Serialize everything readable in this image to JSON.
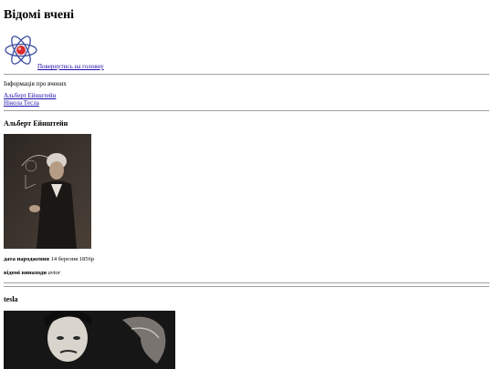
{
  "page": {
    "title": "Відомі вчені",
    "home_link": "Повернутись на головну",
    "info_text": "Інформація про вчених"
  },
  "nav": {
    "items": [
      "Альберт Ейнштейн",
      "Нікола Тесла"
    ]
  },
  "scientists": [
    {
      "name": "Альберт Ейнштейн",
      "birth_label": "дата народження",
      "birth_value": "14 березня 1856р",
      "inventions_label": "відомі винаходи",
      "inventions_value": "avtor"
    },
    {
      "name": "tesla"
    }
  ],
  "colors": {
    "link": "#1a0dab",
    "rule": "#a0a0a0",
    "atom_ring": "#3a4c9c",
    "atom_nucleus": "#d92c2c"
  },
  "icons": {
    "logo": "atom-icon"
  }
}
